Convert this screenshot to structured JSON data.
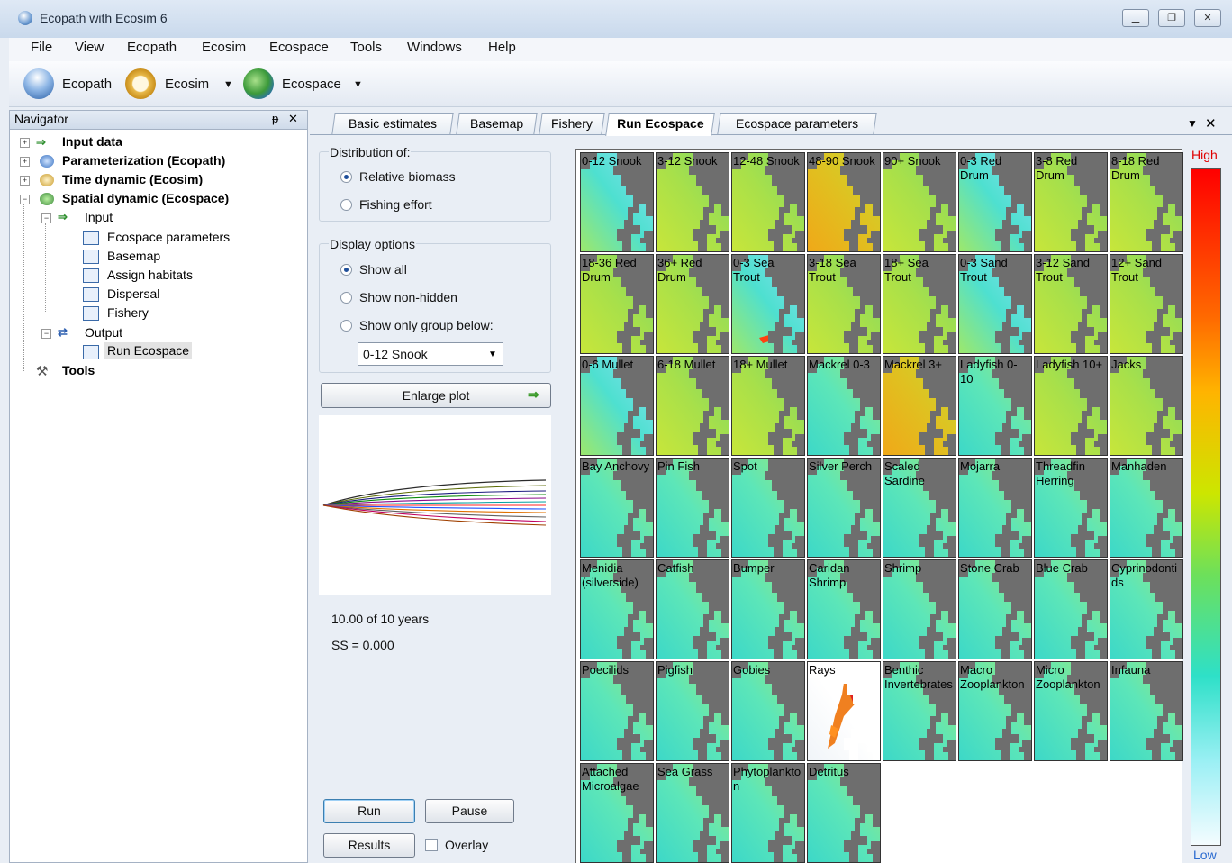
{
  "window": {
    "title": "Ecopath with Ecosim 6",
    "controls": [
      "minimize",
      "restore",
      "close"
    ]
  },
  "menu": [
    "File",
    "View",
    "Ecopath",
    "Ecosim",
    "Ecospace",
    "Tools",
    "Windows",
    "Help"
  ],
  "toolbar": {
    "ecopath": "Ecopath",
    "ecosim": "Ecosim",
    "ecospace": "Ecospace"
  },
  "navigator": {
    "title": "Navigator",
    "pin": "ᵽ",
    "close": "✕",
    "input_data": "Input data",
    "parameterization": "Parameterization (Ecopath)",
    "time_dynamic": "Time dynamic (Ecosim)",
    "spatial_dynamic": "Spatial dynamic  (Ecospace)",
    "input": "Input",
    "input_items": [
      "Ecospace parameters",
      "Basemap",
      "Assign habitats",
      "Dispersal",
      "Fishery"
    ],
    "output": "Output",
    "output_items": [
      "Run Ecospace"
    ],
    "tools": "Tools"
  },
  "tabs": [
    "Basic estimates",
    "Basemap",
    "Fishery",
    "Run Ecospace",
    "Ecospace parameters"
  ],
  "active_tab": "Run Ecospace",
  "panel": {
    "distribution_label": "Distribution of:",
    "dist_options": [
      "Relative biomass",
      "Fishing effort"
    ],
    "display_label": "Display options",
    "display_options": [
      "Show all",
      "Show non-hidden",
      "Show only group below:"
    ],
    "group_select": "0-12 Snook",
    "enlarge": "Enlarge plot",
    "years": "10.00 of 10 years",
    "ss": "SS = 0.000",
    "run": "Run",
    "pause": "Pause",
    "results": "Results",
    "overlay": "Overlay"
  },
  "groups": [
    {
      "name": "0-12 Snook",
      "tone": "mix"
    },
    {
      "name": "3-12 Snook",
      "tone": "green"
    },
    {
      "name": "12-48 Snook",
      "tone": "green"
    },
    {
      "name": "48-90 Snook",
      "tone": "orange"
    },
    {
      "name": "90+ Snook",
      "tone": "green"
    },
    {
      "name": "0-3 Red Drum",
      "tone": "mix"
    },
    {
      "name": "3-8 Red Drum",
      "tone": "green"
    },
    {
      "name": "8-18 Red Drum",
      "tone": "green"
    },
    {
      "name": "18-36 Red Drum",
      "tone": "green"
    },
    {
      "name": "36+ Red Drum",
      "tone": "green"
    },
    {
      "name": "0-3 Sea Trout",
      "tone": "mixred"
    },
    {
      "name": "3-18 Sea Trout",
      "tone": "green"
    },
    {
      "name": "18+ Sea Trout",
      "tone": "green"
    },
    {
      "name": "0-3 Sand Trout",
      "tone": "mix"
    },
    {
      "name": "3-12 Sand Trout",
      "tone": "green"
    },
    {
      "name": "12+ Sand Trout",
      "tone": "green"
    },
    {
      "name": "0-6 Mullet",
      "tone": "mix"
    },
    {
      "name": "6-18 Mullet",
      "tone": "green"
    },
    {
      "name": "18+ Mullet",
      "tone": "green"
    },
    {
      "name": "Mackrel 0-3",
      "tone": "cyan"
    },
    {
      "name": "Mackrel 3+",
      "tone": "orange"
    },
    {
      "name": "Ladyfish 0-10",
      "tone": "cyan"
    },
    {
      "name": "Ladyfish 10+",
      "tone": "green"
    },
    {
      "name": "Jacks",
      "tone": "green"
    },
    {
      "name": "Bay Anchovy",
      "tone": "cyan"
    },
    {
      "name": "Pin Fish",
      "tone": "cyan"
    },
    {
      "name": "Spot",
      "tone": "cyan"
    },
    {
      "name": "Silver Perch",
      "tone": "cyan"
    },
    {
      "name": "Scaled Sardine",
      "tone": "cyan"
    },
    {
      "name": "Mojarra",
      "tone": "cyan"
    },
    {
      "name": "Threadfin Herring",
      "tone": "cyan"
    },
    {
      "name": "Manhaden",
      "tone": "cyan"
    },
    {
      "name": "Menidia (silverside)",
      "tone": "cyan"
    },
    {
      "name": "Catfish",
      "tone": "cyan"
    },
    {
      "name": "Bumper",
      "tone": "cyan"
    },
    {
      "name": "Caridan Shrimp",
      "tone": "cyan"
    },
    {
      "name": "Shrimp",
      "tone": "cyan"
    },
    {
      "name": "Stone Crab",
      "tone": "cyan"
    },
    {
      "name": "Blue Crab",
      "tone": "white"
    },
    {
      "name": "Cyprinodontids",
      "tone": "white"
    },
    {
      "name": "Poecilids",
      "tone": "white"
    },
    {
      "name": "Pigfish",
      "tone": "white"
    },
    {
      "name": "Gobies",
      "tone": "white"
    },
    {
      "name": "Rays",
      "tone": "rays"
    },
    {
      "name": "Benthic Invertebrates",
      "tone": "cyan"
    },
    {
      "name": "Macro Zooplankton",
      "tone": "cyan"
    },
    {
      "name": "Micro Zooplankton",
      "tone": "cyan"
    },
    {
      "name": "Infauna",
      "tone": "cyan"
    },
    {
      "name": "Attached Microalgae",
      "tone": "cyan"
    },
    {
      "name": "Sea Grass",
      "tone": "cyan"
    },
    {
      "name": "Phytoplankton",
      "tone": "cyan"
    },
    {
      "name": "Detritus",
      "tone": "cyan"
    }
  ],
  "legend": {
    "high": "High",
    "low": "Low"
  },
  "colors": {
    "land": "#6e6e6e",
    "accent": "#1e4e9a"
  }
}
